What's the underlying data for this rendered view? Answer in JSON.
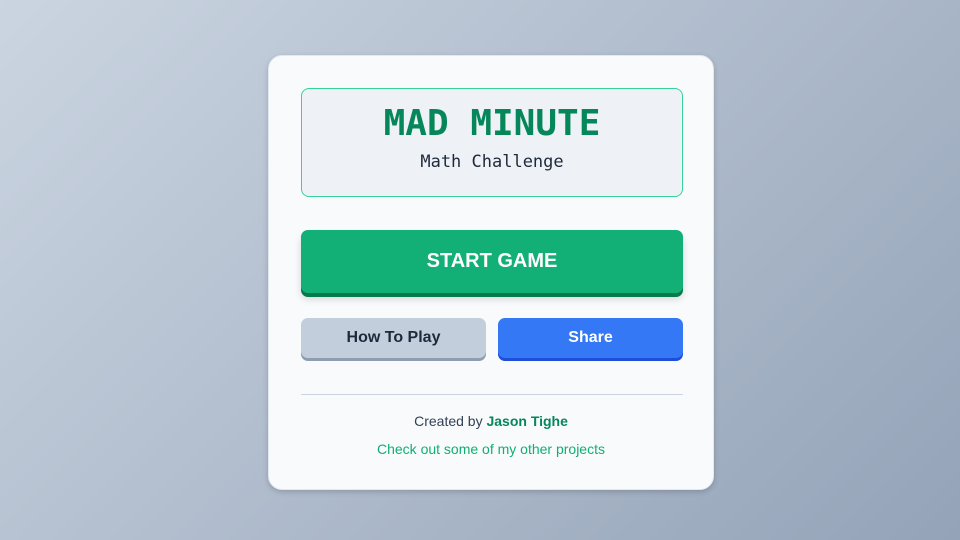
{
  "title": "MAD MINUTE",
  "subtitle": "Math Challenge",
  "buttons": {
    "start": "START GAME",
    "how_to_play": "How To Play",
    "share": "Share"
  },
  "footer": {
    "created_by": "Created by",
    "author": "Jason Tighe",
    "projects_link": "Check out some of my other projects"
  },
  "colors": {
    "accent": "#12b076",
    "share": "#3478f5"
  }
}
